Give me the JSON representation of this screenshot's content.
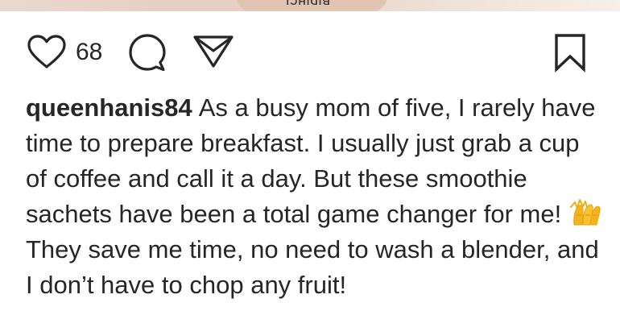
{
  "post": {
    "image_text": "BIDIHCL",
    "likes": "68",
    "caption": {
      "username": "queenhanis84",
      "text_before_emoji": "As a busy mom of five, I rarely have time to prepare breakfast. I usually just grab a cup of coffee and call it a day. But these smoothie sachets have been a total game changer for me!",
      "emoji": "🙌",
      "text_after_emoji": "They save me time, no need to wash a blender, and I don’t have to chop any fruit!"
    }
  },
  "icons": {
    "like": "heart-icon",
    "comment": "comment-icon",
    "share": "send-icon",
    "save": "bookmark-icon",
    "emoji": "raising-hands-icon"
  },
  "colors": {
    "text": "#262626",
    "icon_stroke": "#262626",
    "emoji": "#f2b320"
  }
}
